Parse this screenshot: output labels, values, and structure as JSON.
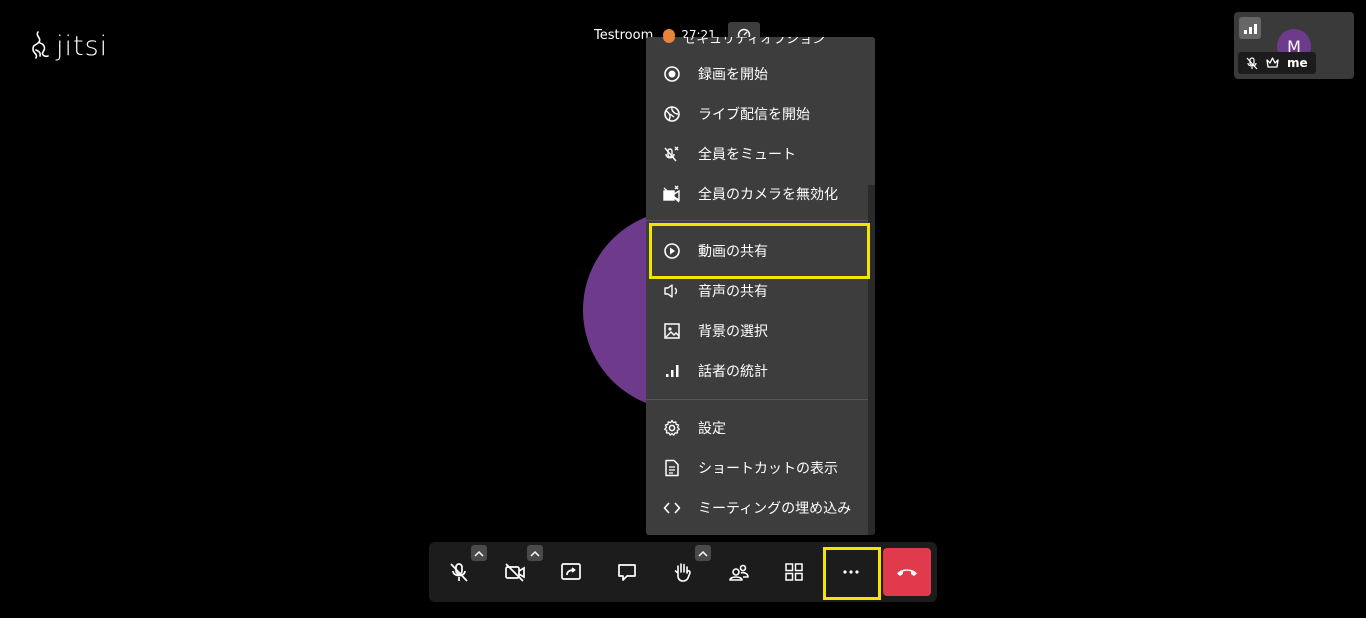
{
  "app": {
    "logo_text": "jitsi",
    "room_name": "Testroom",
    "timer": "27:21"
  },
  "thumbnail": {
    "avatar_initial": "M",
    "name": "me"
  },
  "menu": {
    "partial_top_label": "セキュリティオプション",
    "items": [
      {
        "label": "録画を開始",
        "icon": "record-icon"
      },
      {
        "label": "ライブ配信を開始",
        "icon": "live-stream-icon"
      },
      {
        "label": "全員をミュート",
        "icon": "mute-everyone-icon"
      },
      {
        "label": "全員のカメラを無効化",
        "icon": "camera-off-everyone-icon"
      },
      {
        "label": "動画の共有",
        "icon": "play-icon"
      },
      {
        "label": "音声の共有",
        "icon": "speaker-icon"
      },
      {
        "label": "背景の選択",
        "icon": "image-icon"
      },
      {
        "label": "話者の統計",
        "icon": "stats-icon"
      },
      {
        "label": "設定",
        "icon": "gear-icon"
      },
      {
        "label": "ショートカットの表示",
        "icon": "document-icon"
      },
      {
        "label": "ミーティングの埋め込み",
        "icon": "code-icon"
      }
    ]
  },
  "toolbar": {
    "buttons": [
      {
        "name": "microphone-muted",
        "icon": "mic-off-icon"
      },
      {
        "name": "camera-off",
        "icon": "camera-off-icon"
      },
      {
        "name": "share-screen",
        "icon": "screen-share-icon"
      },
      {
        "name": "chat",
        "icon": "chat-icon"
      },
      {
        "name": "raise-hand",
        "icon": "hand-icon"
      },
      {
        "name": "participants",
        "icon": "participants-icon"
      },
      {
        "name": "tile-view",
        "icon": "grid-icon"
      },
      {
        "name": "more-options",
        "icon": "more-icon"
      },
      {
        "name": "leave",
        "icon": "hangup-icon"
      }
    ],
    "highlight_color": "#f2e600",
    "hangup_color": "#e23a4d"
  }
}
